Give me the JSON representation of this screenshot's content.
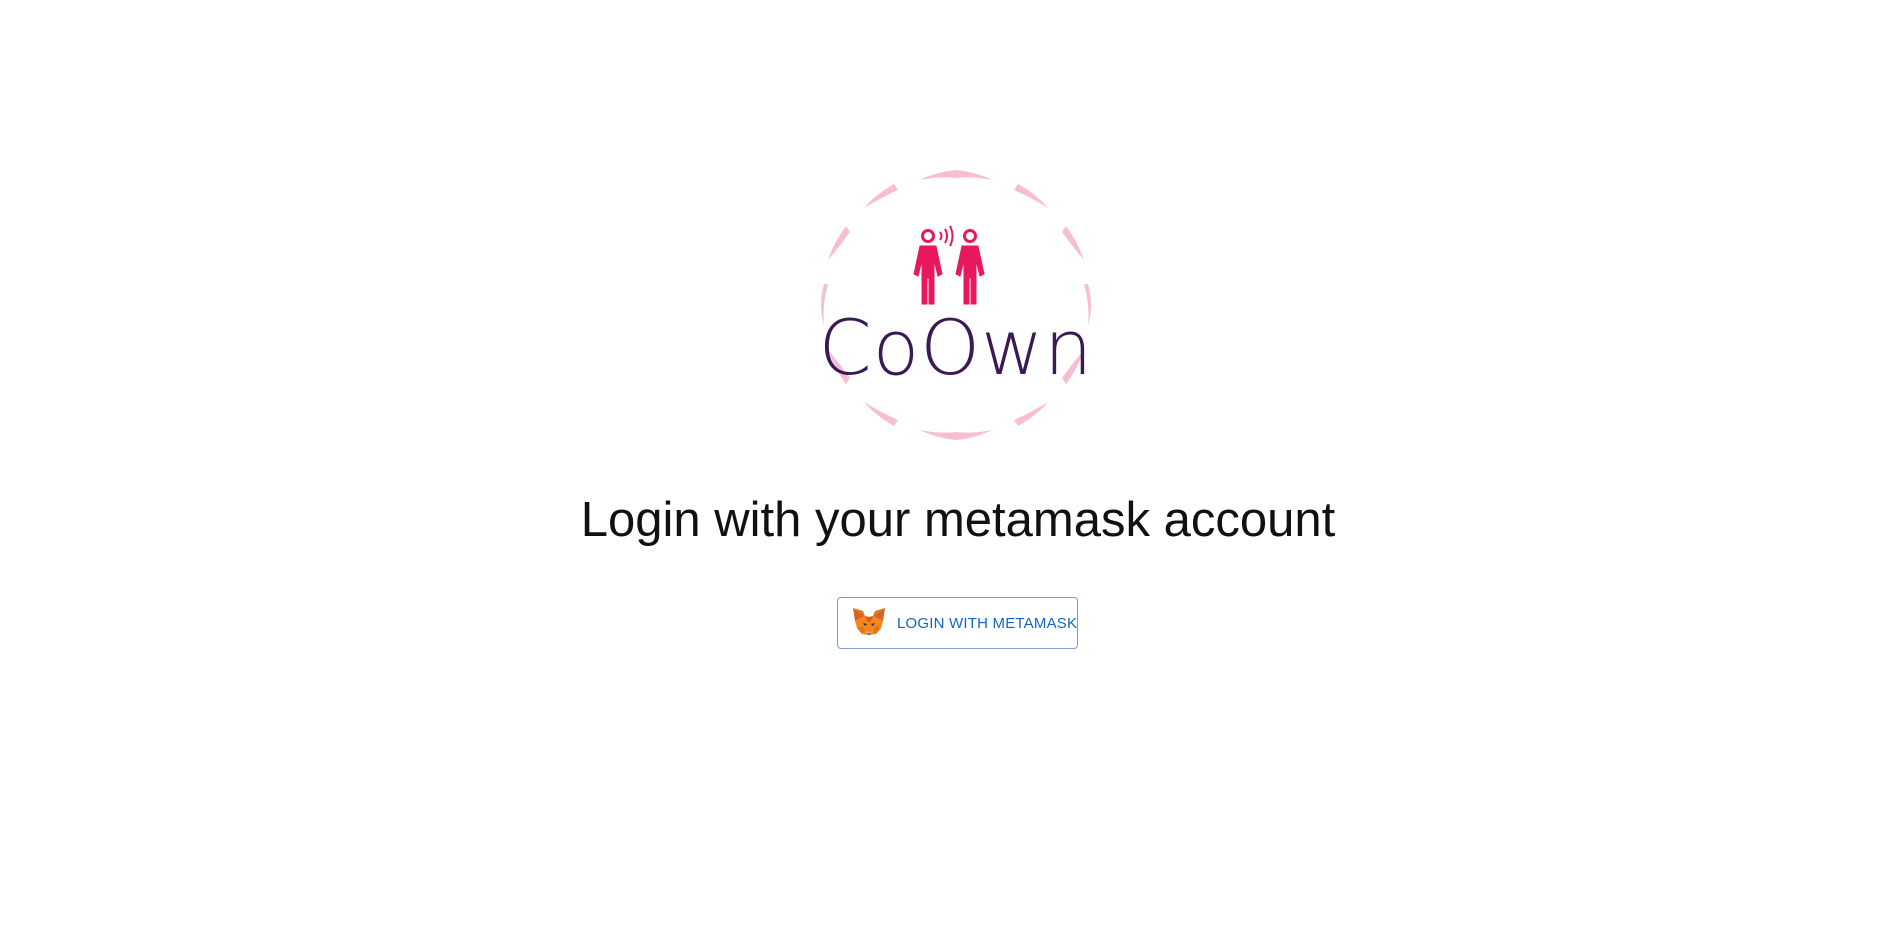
{
  "brand": {
    "name": "CoOwn",
    "text_color": "#3a1a55",
    "accent_color": "#e8185e",
    "ring_color": "#f7b7cf"
  },
  "main": {
    "heading": "Login with your metamask account",
    "login_button": {
      "label": "LOGIN WITH METAMASK",
      "icon": "metamask-fox-icon",
      "text_color": "#1565c0",
      "border_color": "#7f9ed1"
    }
  }
}
